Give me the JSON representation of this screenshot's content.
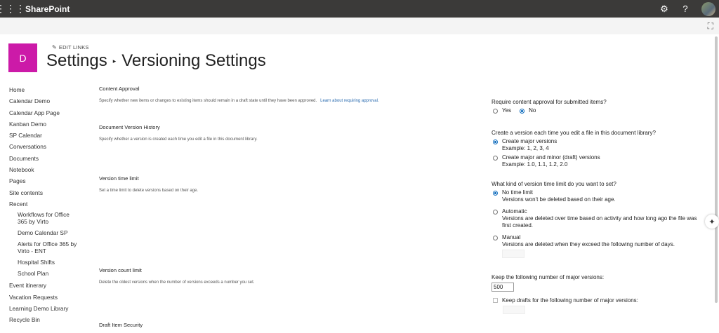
{
  "suite": {
    "brand": "SharePoint",
    "waffle_icon": "waffle-icon",
    "settings_icon": "gear-icon",
    "help_icon": "help-icon"
  },
  "site": {
    "logo_letter": "D",
    "logo_color": "#cc1aa8",
    "edit_links": "EDIT LINKS"
  },
  "title": {
    "parent": "Settings",
    "separator": "▸",
    "current": "Versioning Settings"
  },
  "nav": {
    "items": [
      "Home",
      "Calendar Demo",
      "Calendar App Page",
      "Kanban Demo",
      "SP Calendar",
      "Conversations",
      "Documents",
      "Notebook",
      "Pages",
      "Site contents",
      "Recent"
    ],
    "recent": [
      "Workflows for Office 365 by Virto",
      "Demo Calendar SP",
      "Alerts for Office 365 by Virto - ENT",
      "Hospital Shifts",
      "School Plan"
    ],
    "after": [
      "Event itinerary",
      "Vacation Requests",
      "Learning Demo Library",
      "Recycle Bin"
    ]
  },
  "sections": {
    "content_approval": {
      "title": "Content Approval",
      "desc": "Specify whether new items or changes to existing items should remain in a draft state until they have been approved.",
      "link": "Learn about requiring approval."
    },
    "version_history": {
      "title": "Document Version History",
      "desc": "Specify whether a version is created each time you edit a file in this document library."
    },
    "time_limit": {
      "title": "Version time limit",
      "desc": "Set a time limit to delete versions based on their age."
    },
    "count_limit": {
      "title": "Version count limit",
      "desc": "Delete the oldest versions when the number of versions exceeds a number you set."
    },
    "draft_security": {
      "title": "Draft Item Security"
    }
  },
  "controls": {
    "approval": {
      "question": "Require content approval for submitted items?",
      "yes": "Yes",
      "no": "No",
      "selected": "No"
    },
    "history": {
      "question": "Create a version each time you edit a file in this document library?",
      "major": "Create major versions",
      "major_example": "Example: 1, 2, 3, 4",
      "minor": "Create major and minor (draft) versions",
      "minor_example": "Example: 1.0, 1.1, 1.2, 2.0",
      "selected": "major"
    },
    "timelimit": {
      "question": "What kind of version time limit do you want to set?",
      "none": "No time limit",
      "none_desc": "Versions won't be deleted based on their age.",
      "auto": "Automatic",
      "auto_desc": "Versions are deleted over time based on activity and how long ago the file was first created.",
      "manual": "Manual",
      "manual_desc": "Versions are deleted when they exceed the following number of days.",
      "selected": "none"
    },
    "count": {
      "question": "Keep the following number of major versions:",
      "value": "500",
      "drafts_label": "Keep drafts for the following number of major versions:"
    }
  }
}
